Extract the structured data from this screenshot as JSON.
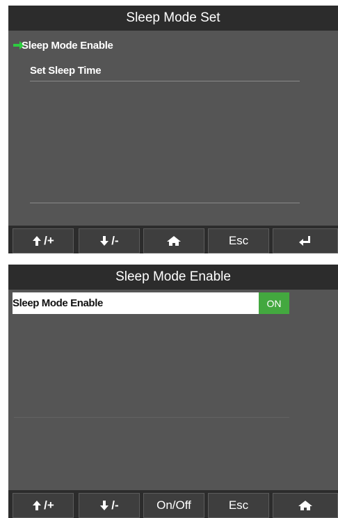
{
  "screen1": {
    "title": "Sleep Mode Set",
    "items": [
      {
        "label": "Sleep Mode Enable",
        "selected": true
      },
      {
        "label": "Set Sleep Time",
        "selected": false
      }
    ],
    "toolbar": {
      "up_label": "/+",
      "down_label": "/-",
      "esc_label": "Esc"
    },
    "icons": {
      "selection": "right-arrow-icon",
      "home": "home-icon",
      "enter": "enter-icon",
      "up": "up-arrow-icon",
      "down": "down-arrow-icon"
    }
  },
  "screen2": {
    "title": "Sleep Mode Enable",
    "setting": {
      "label": "Sleep Mode Enable",
      "value": "ON"
    },
    "toolbar": {
      "up_label": "/+",
      "down_label": "/-",
      "onoff_label": "On/Off",
      "esc_label": "Esc"
    },
    "icons": {
      "home": "home-icon",
      "up": "up-arrow-icon",
      "down": "down-arrow-icon"
    }
  },
  "colors": {
    "screen_bg": "#555555",
    "bar_bg": "#2c2c2c",
    "toggle_on": "#43a83f",
    "selection_arrow": "#2ecc40"
  }
}
